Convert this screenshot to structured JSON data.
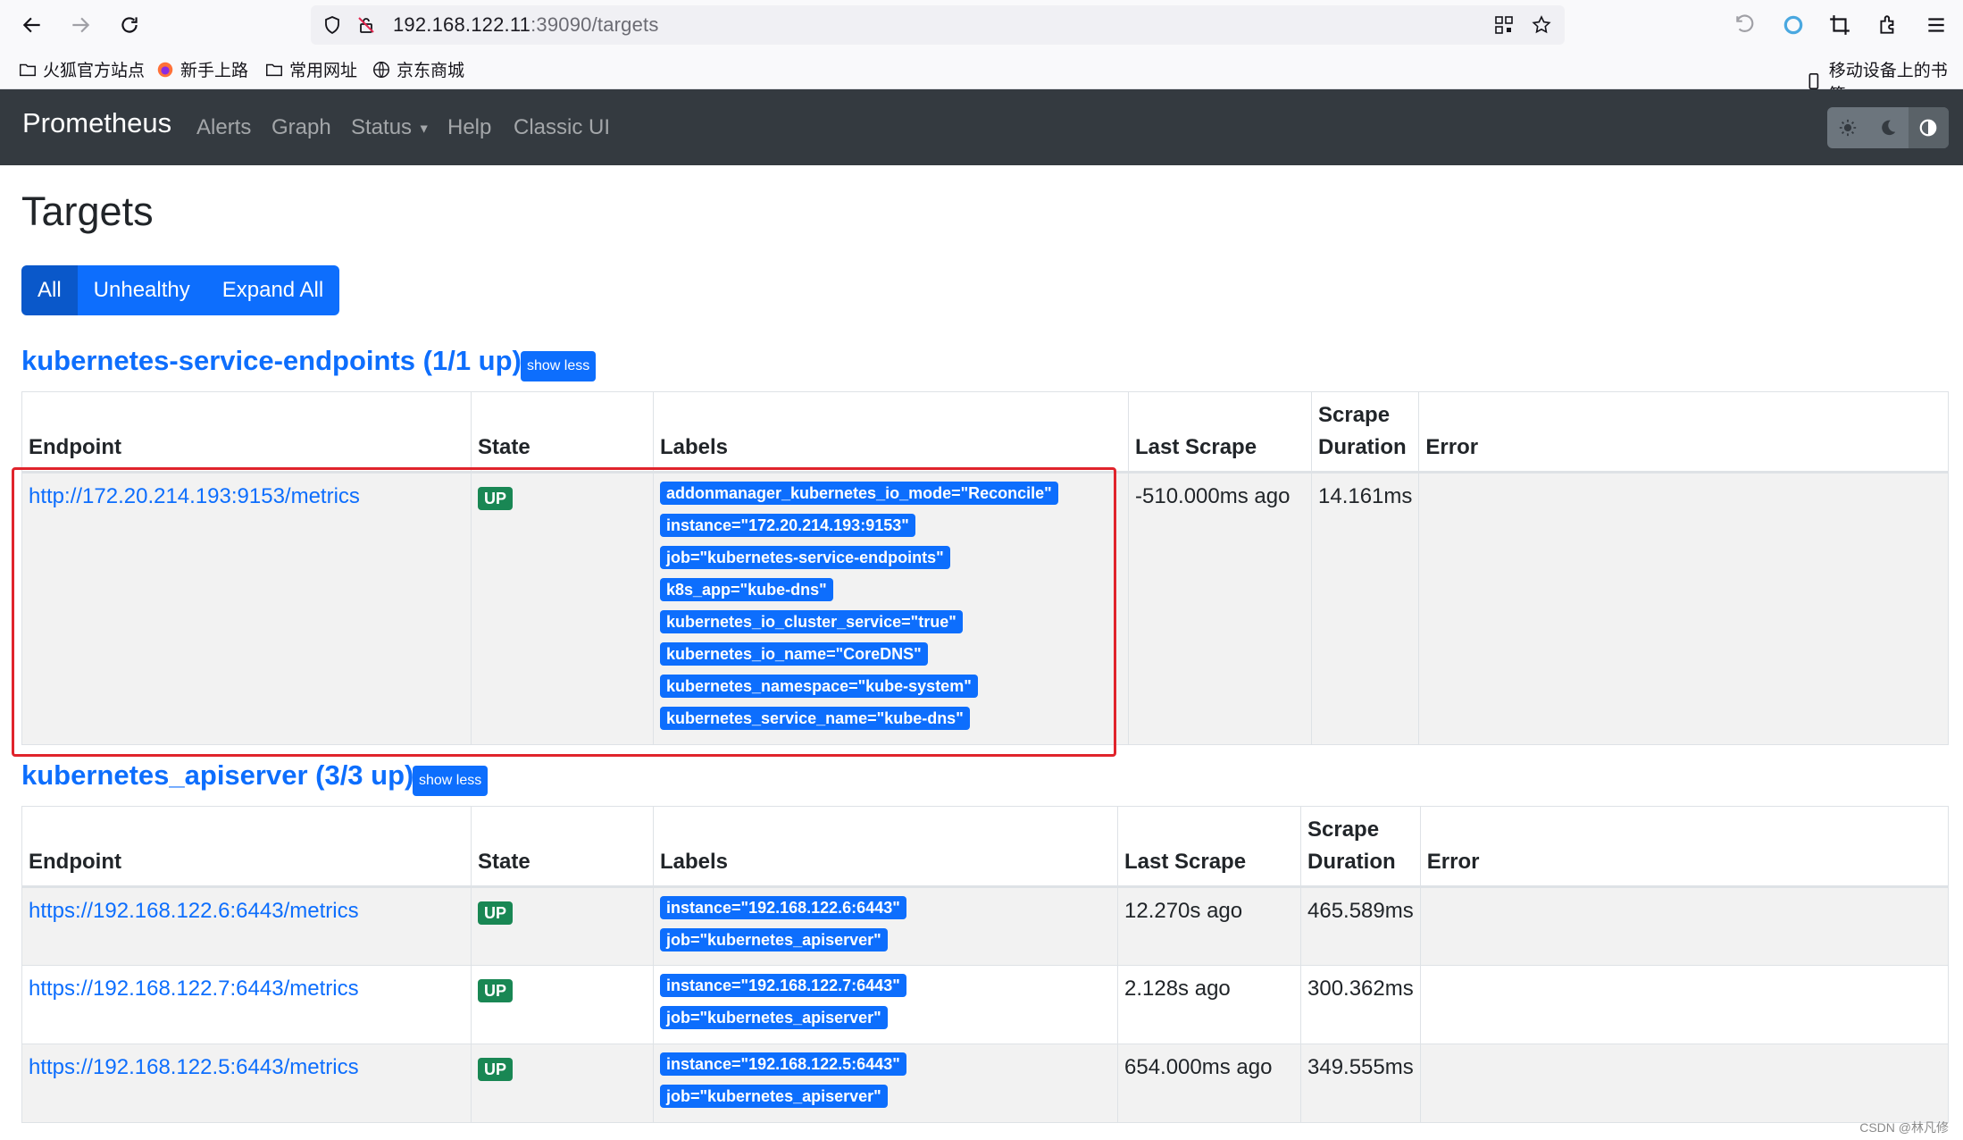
{
  "browser": {
    "url_host": "192.168.122.11",
    "url_path": ":39090/targets",
    "bookmarks": [
      "火狐官方站点",
      "新手上路",
      "常用网址",
      "京东商城"
    ],
    "mobile_bookmarks": "移动设备上的书签"
  },
  "navbar": {
    "brand": "Prometheus",
    "links": [
      "Alerts",
      "Graph",
      "Status",
      "Help",
      "Classic UI"
    ]
  },
  "page": {
    "title": "Targets",
    "filters": [
      "All",
      "Unhealthy",
      "Expand All"
    ],
    "columns": [
      "Endpoint",
      "State",
      "Labels",
      "Last Scrape",
      "Scrape Duration",
      "Error"
    ],
    "columns_split": {
      "scrape_1": "Scrape",
      "scrape_2": "Duration"
    }
  },
  "pools": [
    {
      "title": "kubernetes-service-endpoints (1/1 up)",
      "toggle": "show less",
      "targets": [
        {
          "endpoint": "http://172.20.214.193:9153/metrics",
          "state": "UP",
          "labels": [
            "addonmanager_kubernetes_io_mode=\"Reconcile\"",
            "instance=\"172.20.214.193:9153\"",
            "job=\"kubernetes-service-endpoints\"",
            "k8s_app=\"kube-dns\"",
            "kubernetes_io_cluster_service=\"true\"",
            "kubernetes_io_name=\"CoreDNS\"",
            "kubernetes_namespace=\"kube-system\"",
            "kubernetes_service_name=\"kube-dns\""
          ],
          "last_scrape": "-510.000ms ago",
          "duration": "14.161ms",
          "error": ""
        }
      ]
    },
    {
      "title": "kubernetes_apiserver (3/3 up)",
      "toggle": "show less",
      "targets": [
        {
          "endpoint": "https://192.168.122.6:6443/metrics",
          "state": "UP",
          "labels": [
            "instance=\"192.168.122.6:6443\"",
            "job=\"kubernetes_apiserver\""
          ],
          "last_scrape": "12.270s ago",
          "duration": "465.589ms",
          "error": ""
        },
        {
          "endpoint": "https://192.168.122.7:6443/metrics",
          "state": "UP",
          "labels": [
            "instance=\"192.168.122.7:6443\"",
            "job=\"kubernetes_apiserver\""
          ],
          "last_scrape": "2.128s ago",
          "duration": "300.362ms",
          "error": ""
        },
        {
          "endpoint": "https://192.168.122.5:6443/metrics",
          "state": "UP",
          "labels": [
            "instance=\"192.168.122.5:6443\"",
            "job=\"kubernetes_apiserver\""
          ],
          "last_scrape": "654.000ms ago",
          "duration": "349.555ms",
          "error": ""
        }
      ]
    }
  ],
  "watermark": "CSDN @林凡修",
  "colors": {
    "primary": "#0d6efd",
    "success": "#198754",
    "navbar": "#343a40",
    "highlight": "#e0242c"
  }
}
